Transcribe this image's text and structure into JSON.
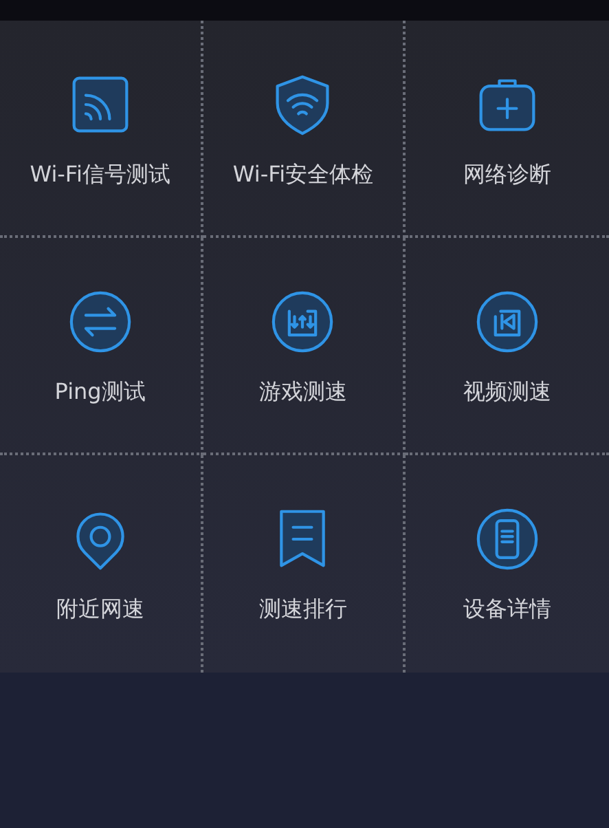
{
  "tools": [
    {
      "label": "Wi-Fi信号测试",
      "kind": "signal"
    },
    {
      "label": "Wi-Fi安全体检",
      "kind": "shield"
    },
    {
      "label": "网络诊断",
      "kind": "kit"
    },
    {
      "label": "Ping测试",
      "kind": "swap"
    },
    {
      "label": "游戏测速",
      "kind": "game"
    },
    {
      "label": "视频测速",
      "kind": "video"
    },
    {
      "label": "附近网速",
      "kind": "pin"
    },
    {
      "label": "测速排行",
      "kind": "ribbon"
    },
    {
      "label": "设备详情",
      "kind": "phone"
    }
  ]
}
